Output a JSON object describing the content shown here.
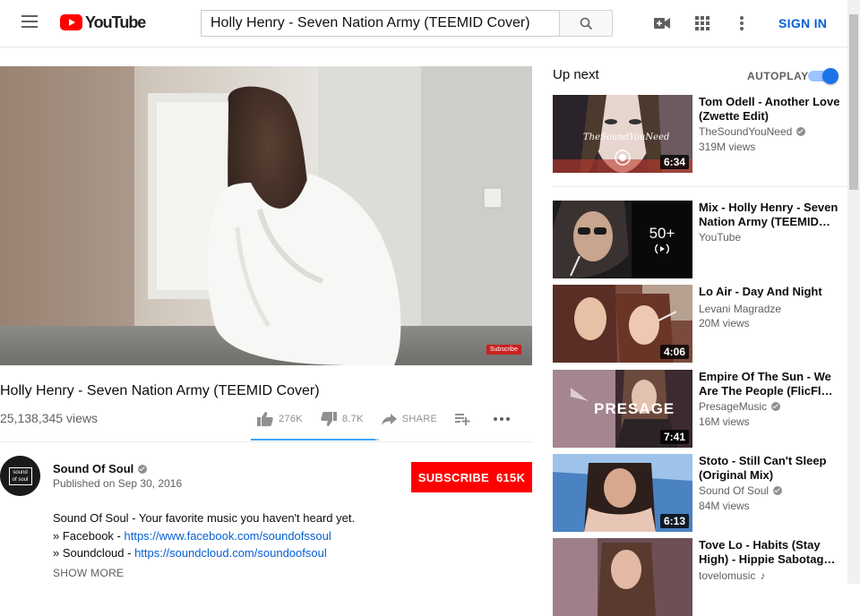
{
  "header": {
    "logo_text": "YouTube",
    "search_value": "Holly Henry - Seven Nation Army (TEEMID Cover)",
    "signin_label": "SIGN IN"
  },
  "player": {
    "badge": "Subscribe"
  },
  "video": {
    "title": "Holly Henry - Seven Nation Army (TEEMID Cover)",
    "views": "25,138,345 views",
    "likes": "276K",
    "dislikes": "8.7K",
    "share_label": "SHARE",
    "like_ratio": 0.97
  },
  "channel": {
    "avatar_text": "sound of soul",
    "name": "Sound Of Soul",
    "published": "Published on Sep 30, 2016",
    "subscribe_label": "SUBSCRIBE",
    "subscriber_count": "615K"
  },
  "description": {
    "line1": "Sound Of Soul  - Your favorite music you haven't heard yet.",
    "facebook_prefix": "» Facebook - ",
    "facebook_link": "https://www.facebook.com/soundofssoul",
    "soundcloud_prefix": "» Soundcloud - ",
    "soundcloud_link": "https://soundcloud.com/soundoofsoul",
    "show_more": "SHOW MORE"
  },
  "sidebar": {
    "up_next_label": "Up next",
    "autoplay_label": "AUTOPLAY",
    "autoplay_on": true,
    "items": [
      {
        "title": "Tom Odell - Another Love (Zwette Edit)",
        "channel": "TheSoundYouNeed",
        "verified": true,
        "views": "319M views",
        "duration": "6:34",
        "thumb_text": "TheSoundYouNeed"
      },
      {
        "title": "Mix - Holly Henry - Seven Nation Army (TEEMID…",
        "channel": "YouTube",
        "verified": false,
        "views": "",
        "playlist_count": "50+"
      },
      {
        "title": "Lo Air - Day And Night",
        "channel": "Levani Magradze",
        "verified": false,
        "views": "20M views",
        "duration": "4:06"
      },
      {
        "title": "Empire Of The Sun - We Are The People (FlicFl…",
        "channel": "PresageMusic",
        "verified": true,
        "views": "16M views",
        "duration": "7:41",
        "thumb_text": "PRESAGE"
      },
      {
        "title": "Stoto - Still Can't Sleep (Original Mix)",
        "channel": "Sound Of Soul",
        "verified": true,
        "views": "84M views",
        "duration": "6:13"
      },
      {
        "title": "Tove Lo - Habits (Stay High) - Hippie Sabotag…",
        "channel": "tovelomusic",
        "verified": false,
        "music_note": true,
        "views": ""
      }
    ]
  },
  "colors": {
    "brand_red": "#ff0000",
    "link_blue": "#065fd4",
    "like_bar_blue": "#3ea6ff",
    "toggle_blue": "#1a73e8"
  }
}
